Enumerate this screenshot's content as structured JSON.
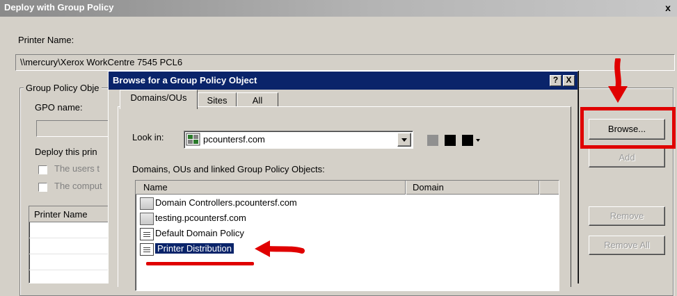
{
  "outer": {
    "title": "Deploy with Group Policy",
    "close_glyph": "x",
    "printer_name_label": "Printer Name:",
    "printer_name_value": "\\\\mercury\\Xerox WorkCentre 7545 PCL6",
    "gpo_group_label": "Group Policy Obje",
    "gpo_name_label": "GPO name:",
    "deploy_label": "Deploy this prin",
    "check_users_label": "The users t",
    "check_computers_label": "The comput",
    "list_header": "Printer Name",
    "buttons": {
      "browse": "Browse...",
      "add": "Add",
      "remove": "Remove",
      "remove_all": "Remove All"
    }
  },
  "dialog": {
    "title": "Browse for a Group Policy Object",
    "help_glyph": "?",
    "close_glyph": "X",
    "tabs": [
      "Domains/OUs",
      "Sites",
      "All"
    ],
    "look_in_label": "Look in:",
    "look_in_value": "pcountersf.com",
    "list_label": "Domains, OUs and linked Group Policy Objects:",
    "columns": [
      "Name",
      "Domain"
    ],
    "items": [
      {
        "name": "Domain Controllers.pcountersf.com",
        "icon": "folder-icon"
      },
      {
        "name": "testing.pcountersf.com",
        "icon": "folder-icon"
      },
      {
        "name": "Default Domain Policy",
        "icon": "gpo-icon"
      },
      {
        "name": "Printer Distribution",
        "icon": "gpo-icon",
        "selected": true
      }
    ]
  },
  "colors": {
    "annotation_red": "#e00000",
    "title_blue": "#0a246a",
    "selection_blue": "#0a246a"
  }
}
